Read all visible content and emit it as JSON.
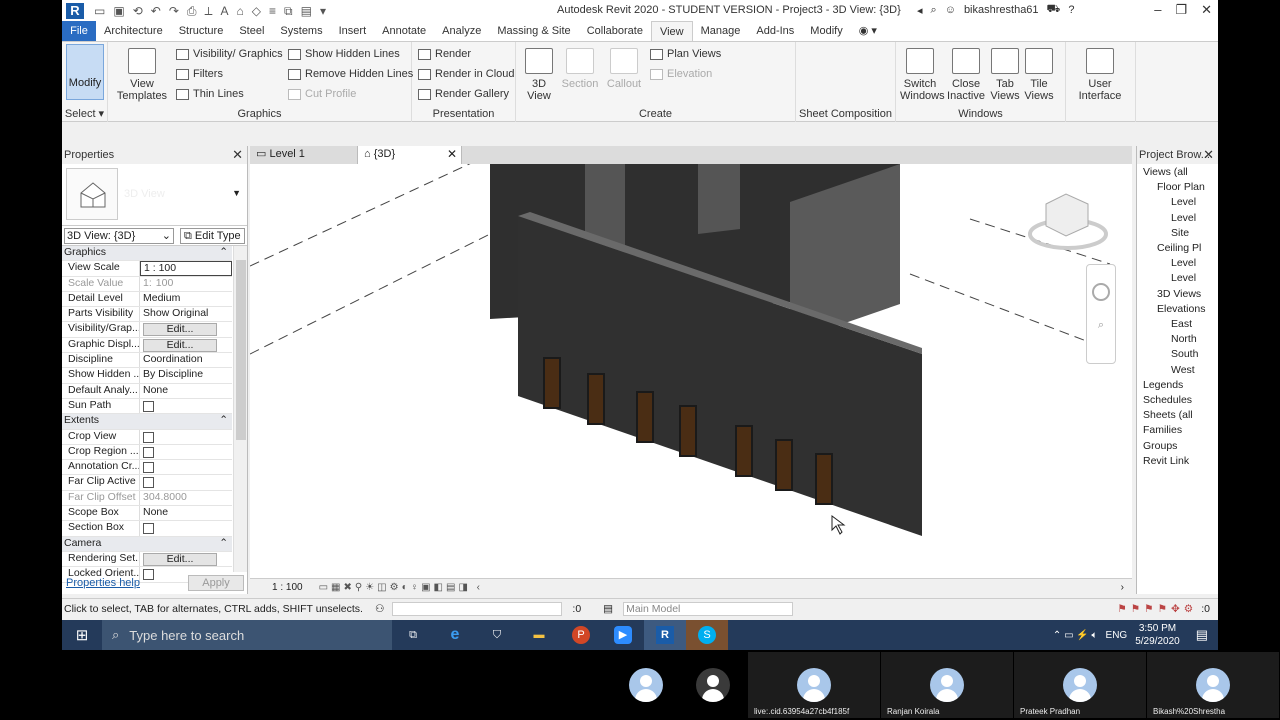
{
  "titlebar": {
    "title": "Autodesk Revit 2020 - STUDENT VERSION - Project3 - 3D View: {3D}",
    "user": "bikashrestha61"
  },
  "tabs": [
    "File",
    "Architecture",
    "Structure",
    "Steel",
    "Systems",
    "Insert",
    "Annotate",
    "Analyze",
    "Massing & Site",
    "Collaborate",
    "View",
    "Manage",
    "Add-Ins",
    "Modify"
  ],
  "ribbon": {
    "select": {
      "modify": "Modify",
      "label": "Select"
    },
    "graphics": {
      "title": "Graphics",
      "view_templates": "View Templates",
      "vis_graphics": "Visibility/ Graphics",
      "filters": "Filters",
      "thin_lines": "Thin Lines",
      "show_hidden": "Show  Hidden Lines",
      "remove_hidden": "Remove  Hidden Lines",
      "cut_profile": "Cut  Profile"
    },
    "presentation": {
      "title": "Presentation",
      "render": "Render",
      "render_cloud": "Render  in Cloud",
      "render_gallery": "Render  Gallery"
    },
    "create": {
      "title": "Create",
      "view3d": "3D View",
      "section": "Section",
      "callout": "Callout",
      "plan_views": "Plan  Views",
      "elevation": "Elevation"
    },
    "sheet": {
      "title": "Sheet Composition"
    },
    "windows": {
      "title": "Windows",
      "switch": "Switch Windows",
      "close_inactive": "Close Inactive",
      "tab_views": "Tab Views",
      "tile_views": "Tile Views",
      "user_interface": "User Interface"
    }
  },
  "properties": {
    "title": "Properties",
    "type_name": "3D View",
    "instance": "3D View: {3D}",
    "edit_type": "Edit Type",
    "rows": [
      {
        "k": "Graphics",
        "sec": true
      },
      {
        "k": "View Scale",
        "v": "1 : 100"
      },
      {
        "k": "Scale Value",
        "v": "100",
        "dim": true,
        "pre": "1:"
      },
      {
        "k": "Detail Level",
        "v": "Medium"
      },
      {
        "k": "Parts Visibility",
        "v": "Show Original"
      },
      {
        "k": "Visibility/Grap...",
        "v": "Edit...",
        "btn": true
      },
      {
        "k": "Graphic Displ...",
        "v": "Edit...",
        "btn": true
      },
      {
        "k": "Discipline",
        "v": "Coordination"
      },
      {
        "k": "Show Hidden ...",
        "v": "By Discipline"
      },
      {
        "k": "Default Analy...",
        "v": "None"
      },
      {
        "k": "Sun Path",
        "cb": true
      },
      {
        "k": "Extents",
        "sec": true
      },
      {
        "k": "Crop View",
        "cb": true
      },
      {
        "k": "Crop Region ...",
        "cb": true
      },
      {
        "k": "Annotation Cr...",
        "cb": true
      },
      {
        "k": "Far Clip Active",
        "cb": true
      },
      {
        "k": "Far Clip Offset",
        "v": "304.8000",
        "dim": true
      },
      {
        "k": "Scope Box",
        "v": "None"
      },
      {
        "k": "Section Box",
        "cb": true
      },
      {
        "k": "Camera",
        "sec": true
      },
      {
        "k": "Rendering Set...",
        "v": "Edit...",
        "btn": true
      },
      {
        "k": "Locked Orient...",
        "cb": true
      }
    ],
    "help": "Properties help",
    "apply": "Apply"
  },
  "view_tabs": [
    {
      "label": "Level 1"
    },
    {
      "label": "{3D}"
    }
  ],
  "view_control": {
    "scale": "1 : 100"
  },
  "browser": {
    "title": "Project Brow...",
    "nodes": [
      "Views (all",
      "Floor Plan",
      "Level",
      "Level",
      "Site",
      "Ceiling Pl",
      "Level",
      "Level",
      "3D Views",
      "Elevations",
      "East",
      "North",
      "South",
      "West",
      "Legends",
      "Schedules",
      "Sheets (all",
      "Families",
      "Groups",
      "Revit Link"
    ]
  },
  "status": {
    "hint": "Click to select, TAB for alternates, CTRL adds, SHIFT unselects.",
    "count": ":0",
    "model": "Main Model",
    "filter": ":0"
  },
  "taskbar": {
    "search": "Type here to search",
    "lang": "ENG",
    "time": "3:50 PM",
    "date": "5/29/2020"
  },
  "meeting": [
    "live:.cid.63954a27cb4f185f",
    "Ranjan Koirala",
    "Prateek Pradhan",
    "Bikash%20Shrestha"
  ]
}
